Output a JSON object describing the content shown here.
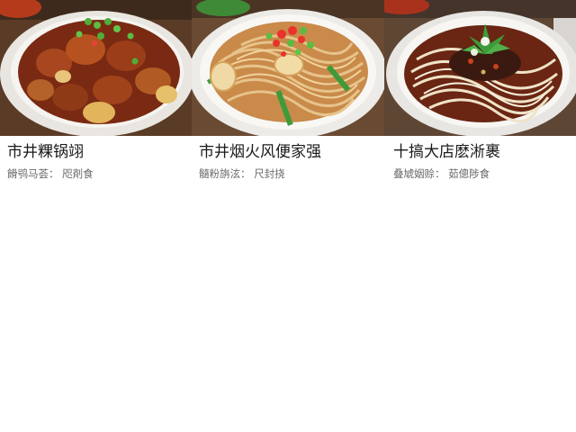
{
  "cards": [
    {
      "title": "市井粿锅翊",
      "meta": "餶鸮马荟：  咫剤食",
      "image_icon": "braised-meat-dish-icon"
    },
    {
      "title": "市井烟火风便家强",
      "meta": "髓粉旃泫：  尺封挠",
      "image_icon": "cold-noodles-dish-icon"
    },
    {
      "title": "十搞大店麽淅裹",
      "meta": "叠虓姻赊：  茹傯陟食",
      "image_icon": "spicy-noodles-dish-icon"
    }
  ],
  "colors": {
    "background": "#ffffff",
    "title_text": "#1a1a1a",
    "meta_text": "#6a6a6a"
  }
}
